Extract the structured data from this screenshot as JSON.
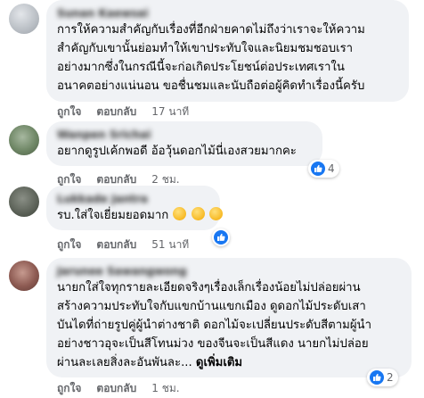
{
  "comments": [
    {
      "author": "Sunan Kaewsai",
      "lines": [
        "การให้ความสำคัญกับเรื่องที่อีกฝ่ายคาดไม่ถึงว่าเราจะให้ความ",
        "สำคัญกับเขานั้นย่อมทำให้เขาประทับใจและนิยมชมชอบเรา",
        "อย่างมากซึ่งในกรณีนี้จะก่อเกิดประโยชน์ต่อประเทศเราใน",
        "อนาคตอย่างแน่นอน ขอชื่นชมและนับถือต่อผู้คิดทำเรื่องนี้ครับ"
      ],
      "like_label": "ถูกใจ",
      "reply_label": "ตอบกลับ",
      "time": "17 นาที"
    },
    {
      "author": "Wanpen Srichai",
      "lines": [
        "อยากดูรูปเค้กพอดี อ้อวุ้นดอกไม้นี่เองสวยมากคะ"
      ],
      "like_label": "ถูกใจ",
      "reply_label": "ตอบกลับ",
      "time": "2 ชม.",
      "reaction_count": "4"
    },
    {
      "author": "Lukkade Jantra",
      "lines": [
        "รบ.ใส่ใจเยี่ยมยอดมาก"
      ],
      "emojis": [
        "clapping-hands-emoji",
        "clapping-hands-emoji",
        "clapping-hands-emoji"
      ],
      "like_label": "ถูกใจ",
      "reply_label": "ตอบกลับ",
      "time": "51 นาที"
    },
    {
      "author": "Jarunee Sawangwong",
      "lines": [
        "นายกใส่ใจทุกรายละเอียดจริงๆเรื่องเล็กเรื่องน้อยไม่ปล่อยผ่าน",
        "สร้างความประทับใจกับแขกบ้านแขกเมือง ดูดอกไม้ประดับเสา",
        "บันไดที่ถ่ายรูปคู่ผู้นำต่างชาติ ดอกไม้จะเปลี่ยนประดับสีตามผู้นำ",
        "อย่างชาวอุจะเป็นสีโทนม่วง ของจีนจะเป็นสีแดง นายกไม่ปล่อย",
        "ผ่านละเลยสิ่งละอันพันละ..."
      ],
      "see_more": "ดูเพิ่มเติม",
      "like_label": "ถูกใจ",
      "reply_label": "ตอบกลับ",
      "time": "1 ชม.",
      "reaction_count": "2"
    }
  ],
  "colors": {
    "like_blue": "#1877f2",
    "bubble_bg": "#f0f2f5",
    "meta_gray": "#65676b"
  },
  "icons": {
    "like": "thumbs-up-icon"
  }
}
